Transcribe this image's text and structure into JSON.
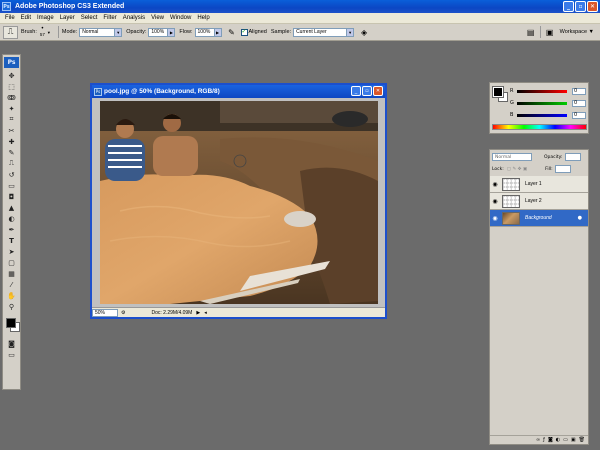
{
  "app": {
    "title": "Adobe Photoshop CS3 Extended",
    "logo": "Ps",
    "window_controls": [
      "minimize",
      "maximize",
      "close"
    ]
  },
  "menu": [
    "File",
    "Edit",
    "Image",
    "Layer",
    "Select",
    "Filter",
    "Analysis",
    "View",
    "Window",
    "Help"
  ],
  "options": {
    "brush_label": "Brush:",
    "brush_size": "57",
    "mode_label": "Mode:",
    "mode_value": "Normal",
    "opacity_label": "Opacity:",
    "opacity_value": "100%",
    "flow_label": "Flow:",
    "flow_value": "100%",
    "aligned_label": "Aligned",
    "aligned_checked": true,
    "sample_label": "Sample:",
    "sample_value": "Current Layer",
    "workspace_label": "Workspace ▼"
  },
  "document": {
    "title": "pool.jpg @ 50% (Background, RGB/8)",
    "zoom": "50%",
    "doc_info": "Doc: 2.29M/4.09M"
  },
  "color_panel": {
    "channels": [
      {
        "label": "R",
        "value": "0"
      },
      {
        "label": "G",
        "value": "0"
      },
      {
        "label": "B",
        "value": "0"
      }
    ],
    "foreground": "#000000",
    "background": "#ffffff"
  },
  "layers_panel": {
    "blend_mode": "Normal",
    "opacity_label": "Opacity:",
    "lock_label": "Lock:",
    "fill_label": "Fill:",
    "layers": [
      {
        "name": "Layer 1",
        "visible": true,
        "active": false
      },
      {
        "name": "Layer 2",
        "visible": true,
        "active": false
      },
      {
        "name": "Background",
        "visible": true,
        "active": true
      }
    ]
  }
}
